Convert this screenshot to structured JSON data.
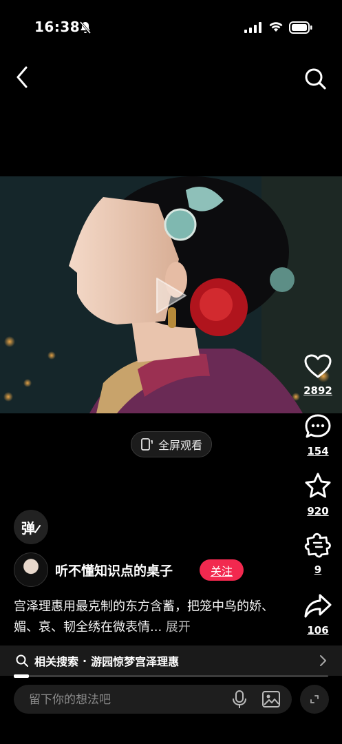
{
  "status": {
    "time": "16:38"
  },
  "icons": {
    "back": "chevron-left-icon",
    "search": "search-icon",
    "play": "play-icon",
    "like": "heart-icon",
    "comment": "comment-bubble-icon",
    "favorite": "star-icon",
    "share_other": "puzzle-icon",
    "share": "share-arrow-icon"
  },
  "player": {
    "fullscreen_label": "全屏观看"
  },
  "rail": {
    "likes": "2892",
    "comments": "154",
    "favorites": "920",
    "puzzle": "9",
    "shares": "106"
  },
  "danmaku_label": "弹",
  "author": {
    "name": "听不懂知识点的桌子",
    "follow_label": "关注"
  },
  "post": {
    "description": "宫泽理惠用最克制的东方含蓄，把笼中鸟的娇、媚、哀、韧全绣在微表情...",
    "expand_label": "展开"
  },
  "related": {
    "label": "相关搜索",
    "separator": "·",
    "query": "游园惊梦宫泽理惠"
  },
  "comment_bar": {
    "placeholder": "留下你的想法吧"
  },
  "colors": {
    "accent": "#f2294f",
    "background": "#000000"
  }
}
